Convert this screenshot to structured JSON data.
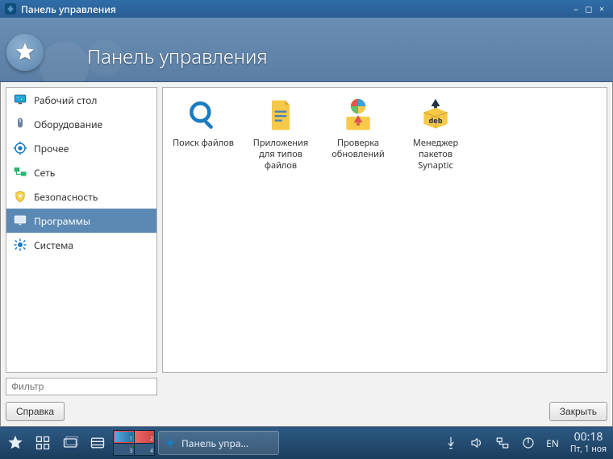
{
  "window": {
    "title": "Панель управления"
  },
  "banner": {
    "title": "Панель управления"
  },
  "sidebar": {
    "items": [
      {
        "label": "Рабочий стол"
      },
      {
        "label": "Оборудование"
      },
      {
        "label": "Прочее"
      },
      {
        "label": "Сеть"
      },
      {
        "label": "Безопасность"
      },
      {
        "label": "Программы"
      },
      {
        "label": "Система"
      }
    ],
    "selected_index": 5
  },
  "apps": [
    {
      "label": "Поиск файлов"
    },
    {
      "label": "Приложения для типов файлов"
    },
    {
      "label": "Проверка обновлений"
    },
    {
      "label": "Менеджер пакетов Synaptic"
    }
  ],
  "filter": {
    "placeholder": "Фильтр"
  },
  "buttons": {
    "help": "Справка",
    "close": "Закрыть"
  },
  "taskbar": {
    "active_task": "Панель упра...",
    "pager_labels": [
      "1",
      "2",
      "3",
      "4"
    ],
    "pager_active": 0,
    "lang": "EN",
    "time": "00:18",
    "date": "Пт, 1 ноя"
  }
}
